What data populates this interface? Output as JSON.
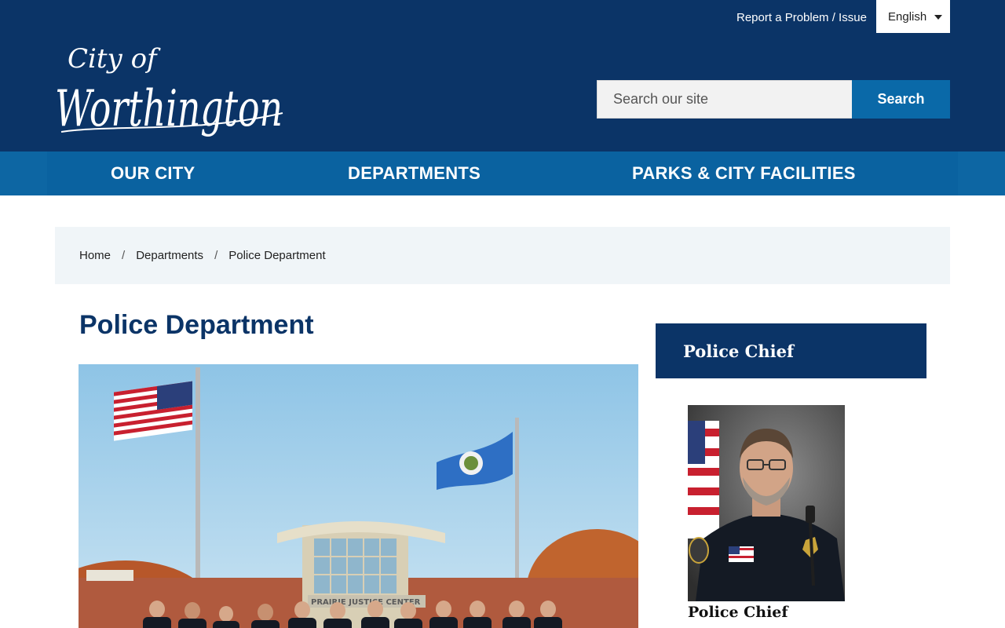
{
  "header": {
    "report_link": "Report a Problem / Issue",
    "language": "English",
    "logo_text_top": "City of",
    "logo_text_main": "Worthington",
    "search_placeholder": "Search our site",
    "search_button": "Search"
  },
  "nav": {
    "items": [
      {
        "label": "OUR CITY"
      },
      {
        "label": "DEPARTMENTS"
      },
      {
        "label": "PARKS & CITY FACILITIES"
      }
    ]
  },
  "breadcrumb": {
    "items": [
      {
        "label": "Home"
      },
      {
        "label": "Departments"
      },
      {
        "label": "Police Department"
      }
    ],
    "separator": "/"
  },
  "main": {
    "title": "Police Department",
    "hero_sign_text": "PRAIRIE JUSTICE CENTER"
  },
  "sidebar": {
    "heading": "Police Chief",
    "caption": "Police Chief"
  },
  "colors": {
    "header_bg": "#0b3467",
    "nav_bg": "#0a62a0",
    "accent": "#0a69a8",
    "breadcrumb_bg": "#f0f5f8"
  }
}
